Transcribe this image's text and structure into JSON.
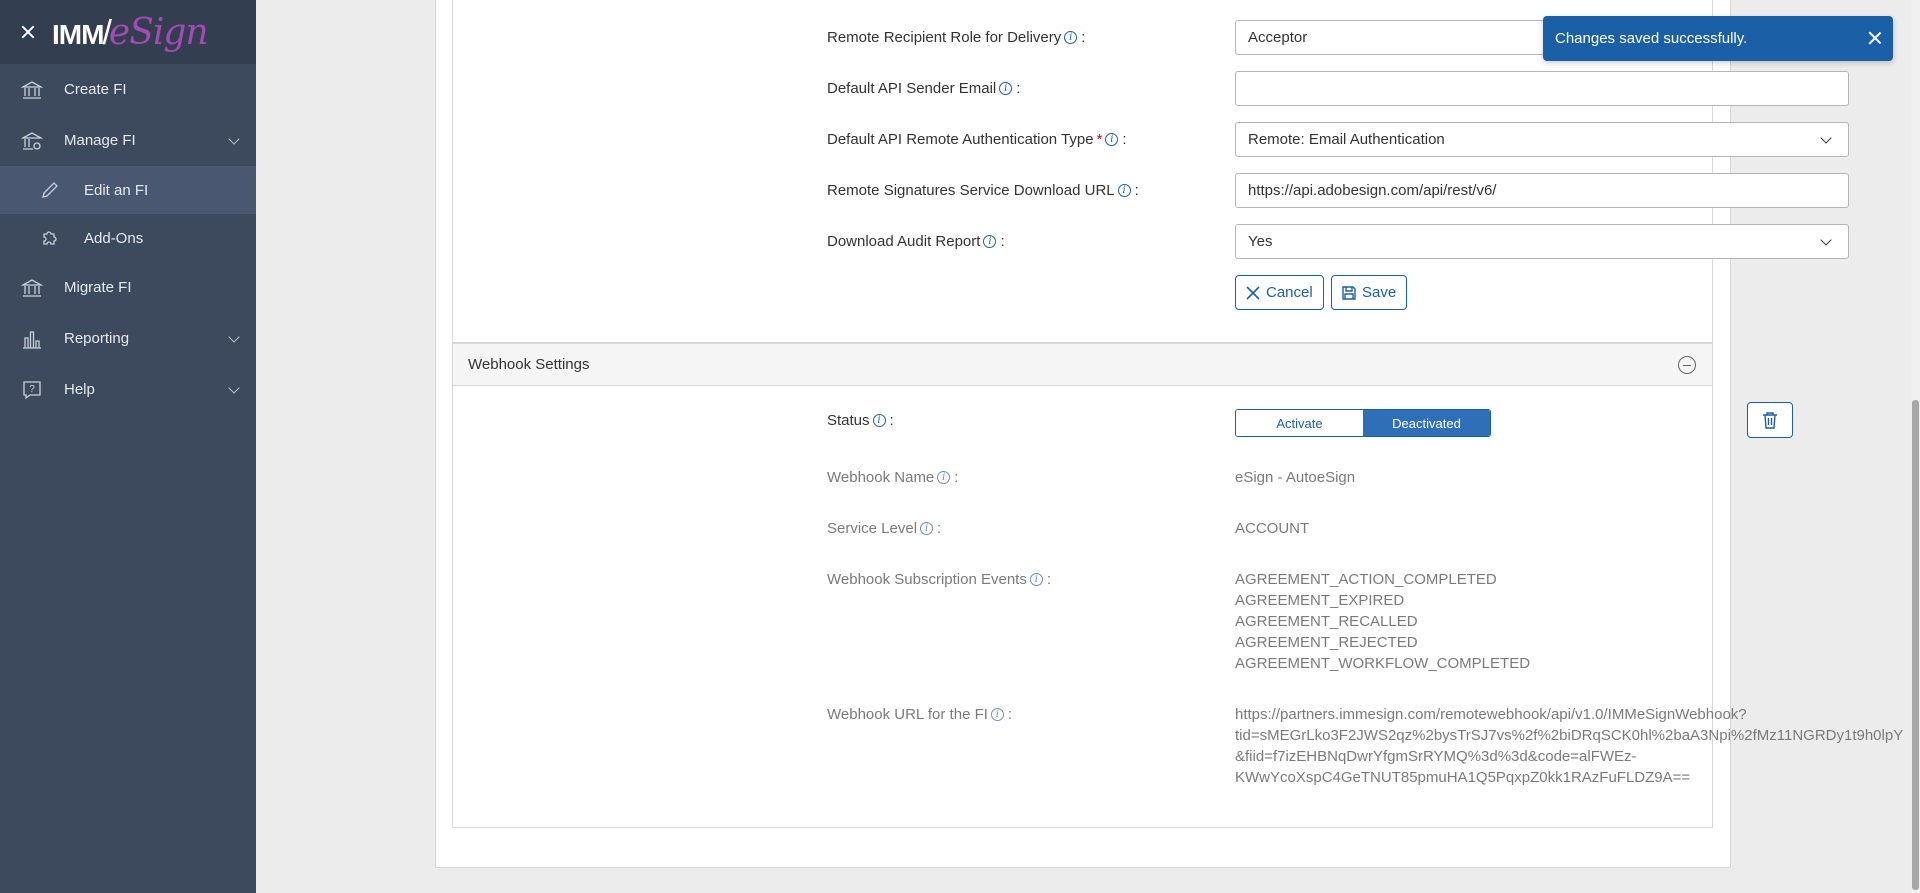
{
  "sidebar": {
    "logo_text_imm": "IMM",
    "logo_text_esign": "eSign",
    "items": [
      {
        "label": "Create FI",
        "icon": "bank-icon"
      },
      {
        "label": "Manage FI",
        "icon": "bank-gear-icon"
      },
      {
        "label": "Edit an FI",
        "icon": "pencil-icon"
      },
      {
        "label": "Add-Ons",
        "icon": "puzzle-icon"
      },
      {
        "label": "Migrate FI",
        "icon": "bank-icon"
      },
      {
        "label": "Reporting",
        "icon": "bar-chart-icon"
      },
      {
        "label": "Help",
        "icon": "help-bubble-icon"
      }
    ]
  },
  "form": {
    "recipient_role_label": "Remote Recipient Role for Delivery",
    "recipient_role_value": "Acceptor",
    "sender_email_label": "Default API Sender Email",
    "sender_email_value": "",
    "auth_type_label": "Default API Remote Authentication Type",
    "auth_type_required": "*",
    "auth_type_value": "Remote: Email Authentication",
    "download_url_label": "Remote Signatures Service Download URL",
    "download_url_value": "https://api.adobesign.com/api/rest/v6/",
    "audit_report_label": "Download Audit Report",
    "audit_report_value": "Yes",
    "colon": ":",
    "cancel_label": "Cancel",
    "save_label": "Save"
  },
  "webhook": {
    "section_title": "Webhook Settings",
    "status_label": "Status",
    "activate_label": "Activate",
    "deactivated_label": "Deactivated",
    "status_value": "Deactivated",
    "name_label": "Webhook Name",
    "name_value": "eSign - AutoeSign",
    "service_level_label": "Service Level",
    "service_level_value": "ACCOUNT",
    "events_label": "Webhook Subscription Events",
    "events": [
      "AGREEMENT_ACTION_COMPLETED",
      "AGREEMENT_EXPIRED",
      "AGREEMENT_RECALLED",
      "AGREEMENT_REJECTED",
      "AGREEMENT_WORKFLOW_COMPLETED"
    ],
    "url_label": "Webhook URL for the FI",
    "url_lines": [
      "https://partners.immesign.com/remotewebhook/api/v1.0/IMMeSignWebhook?",
      "tid=sMEGrLko3F2JWS2qz%2bysTrSJ7vs%2f%2biDRqSCK0hl%2baA3Npi%2fMz11NGRDy1t9h0lpY",
      "&fiid=f7izEHBNqDwrYfgmSrRYMQ%3d%3d&code=alFWEz-",
      "KWwYcoXspC4GeTNUT85pmuHA1Q5PqxpZ0kk1RAzFuFLDZ9A=="
    ]
  },
  "toast": {
    "message": "Changes saved successfully."
  },
  "colors": {
    "sidebar_bg": "#3d4a5e",
    "accent": "#1b5fa7",
    "brand_purple": "#a34ab4"
  }
}
